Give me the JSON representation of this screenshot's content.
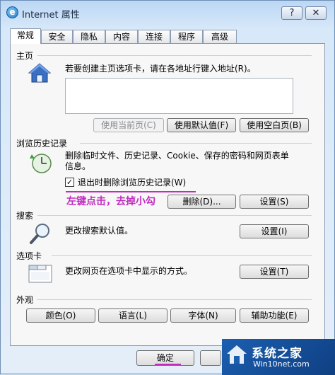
{
  "window": {
    "title": "Internet 属性",
    "help_glyph": "?",
    "close_glyph": "✕"
  },
  "tabs": [
    "常规",
    "安全",
    "隐私",
    "内容",
    "连接",
    "程序",
    "高级"
  ],
  "home": {
    "heading": "主页",
    "desc": "若要创建主页选项卡，请在各地址行键入地址(R)。",
    "btn_current": "使用当前页(C)",
    "btn_default": "使用默认值(F)",
    "btn_blank": "使用空白页(B)"
  },
  "history": {
    "heading": "浏览历史记录",
    "desc_line1": "删除临时文件、历史记录、Cookie、保存的密码和网页表单",
    "desc_line2": "信息。",
    "checkbox_mark": "✓",
    "checkbox_label": "退出时删除浏览历史记录(W)",
    "annotation": "左键点击，去掉小勾",
    "btn_delete": "删除(D)...",
    "btn_settings": "设置(S)"
  },
  "search": {
    "heading": "搜索",
    "desc": "更改搜索默认值。",
    "btn_settings": "设置(I)"
  },
  "tabs_section": {
    "heading": "选项卡",
    "desc": "更改网页在选项卡中显示的方式。",
    "btn_settings": "设置(T)"
  },
  "appearance": {
    "heading": "外观",
    "btn_colors": "颜色(O)",
    "btn_languages": "语言(L)",
    "btn_fonts": "字体(N)",
    "btn_accessibility": "辅助功能(E)"
  },
  "footer": {
    "ok": "确定"
  },
  "watermark": {
    "name": "系统之家",
    "url": "Win10net.com"
  }
}
